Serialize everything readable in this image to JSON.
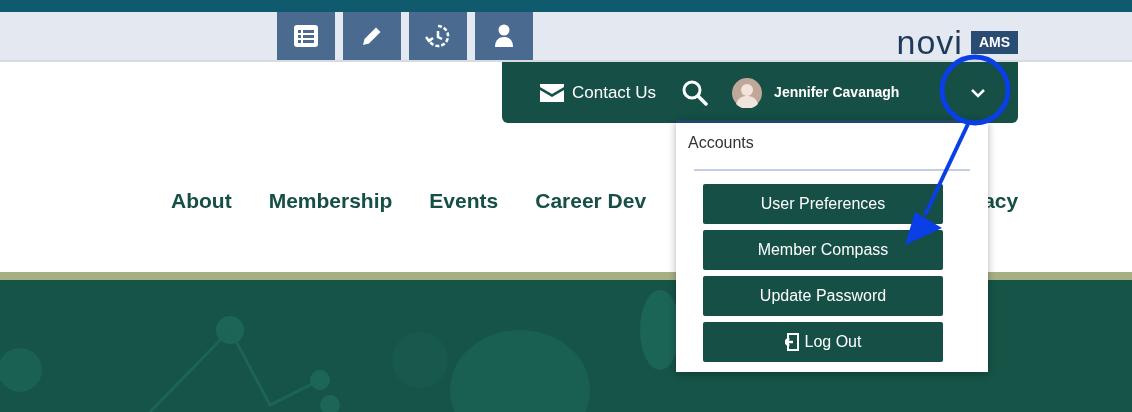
{
  "logo": {
    "name": "novi",
    "badge": "AMS"
  },
  "header_bar": {
    "contact": "Contact Us",
    "user_name": "Jennifer Cavanagh"
  },
  "nav": [
    "About",
    "Membership",
    "Events",
    "Career Dev",
    "acy"
  ],
  "dropdown": {
    "title": "Accounts",
    "items": [
      {
        "label": "User Preferences",
        "kind": "plain"
      },
      {
        "label": "Member Compass",
        "kind": "plain"
      },
      {
        "label": "Update Password",
        "kind": "plain"
      },
      {
        "label": "Log Out",
        "kind": "logout"
      }
    ]
  }
}
